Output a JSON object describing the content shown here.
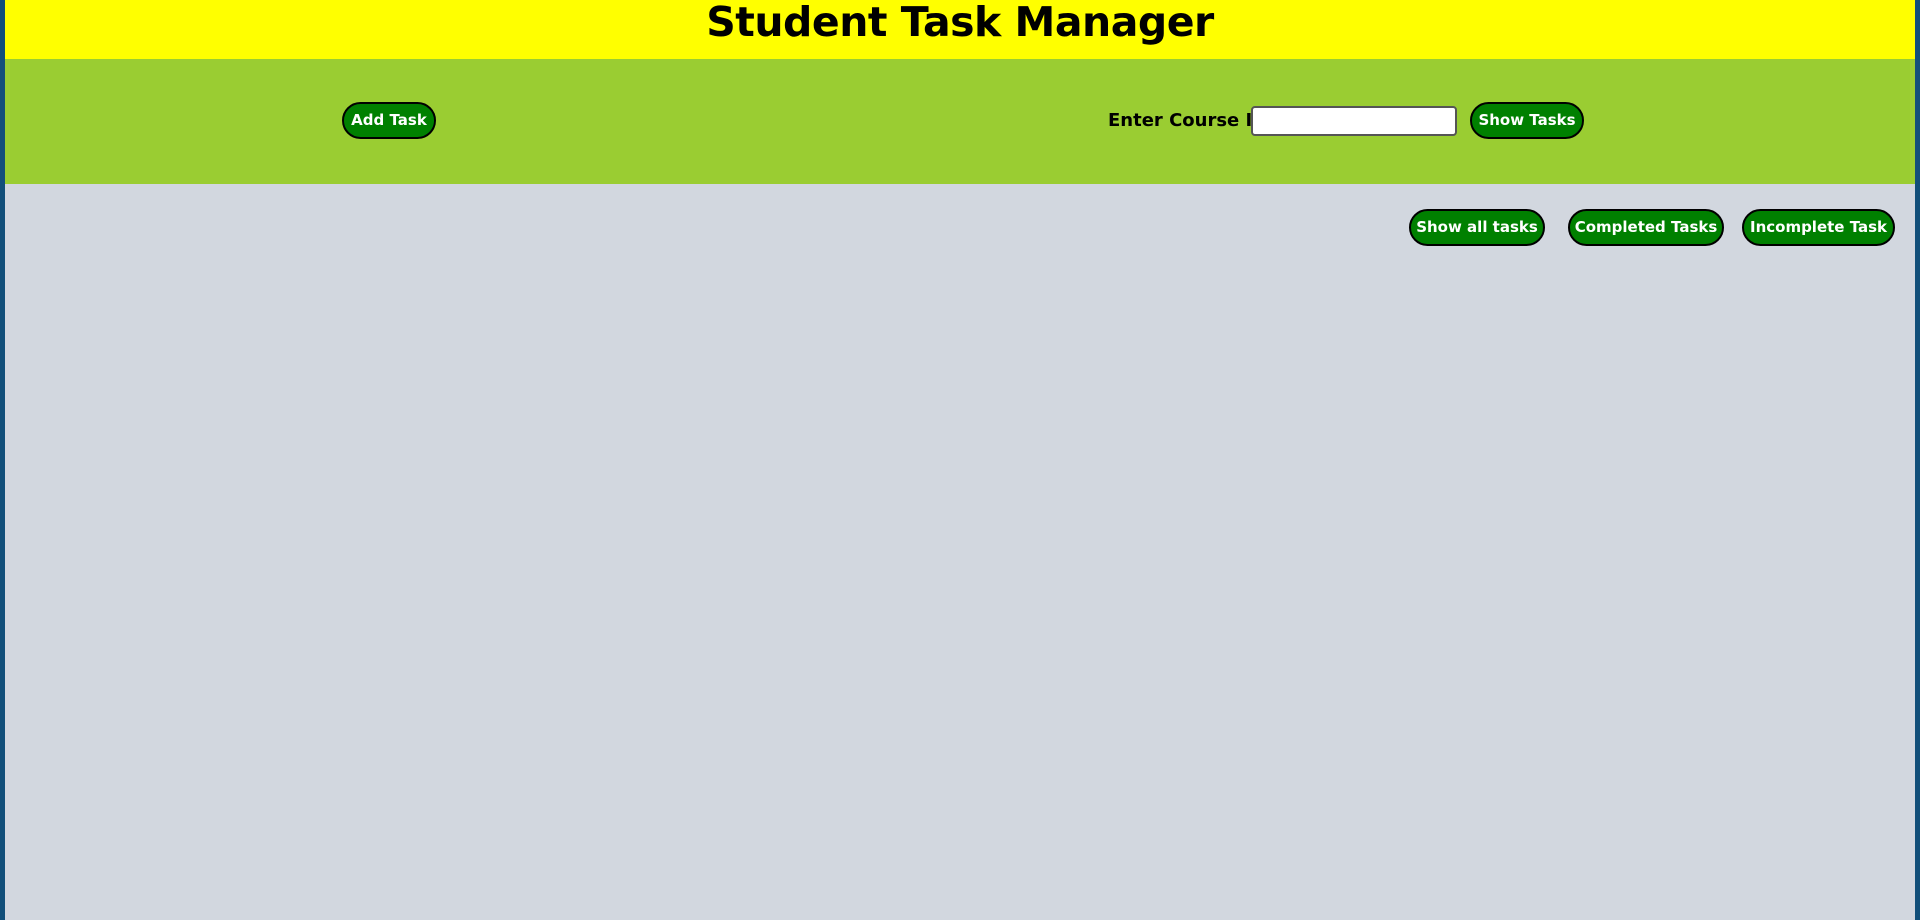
{
  "header": {
    "title": "Student Task Manager"
  },
  "toolbar": {
    "add_task_label": "Add Task",
    "course_id_label": "Enter Course ID",
    "course_id_value": "",
    "show_tasks_label": "Show Tasks"
  },
  "filters": {
    "show_all_label": "Show all tasks",
    "completed_label": "Completed Tasks",
    "incomplete_label": "Incomplete Task"
  },
  "colors": {
    "header_bg": "#ffff00",
    "toolbar_bg": "#9acd32",
    "content_bg": "#d2d7df",
    "button_bg": "#008000",
    "page_border": "#124f7a"
  }
}
